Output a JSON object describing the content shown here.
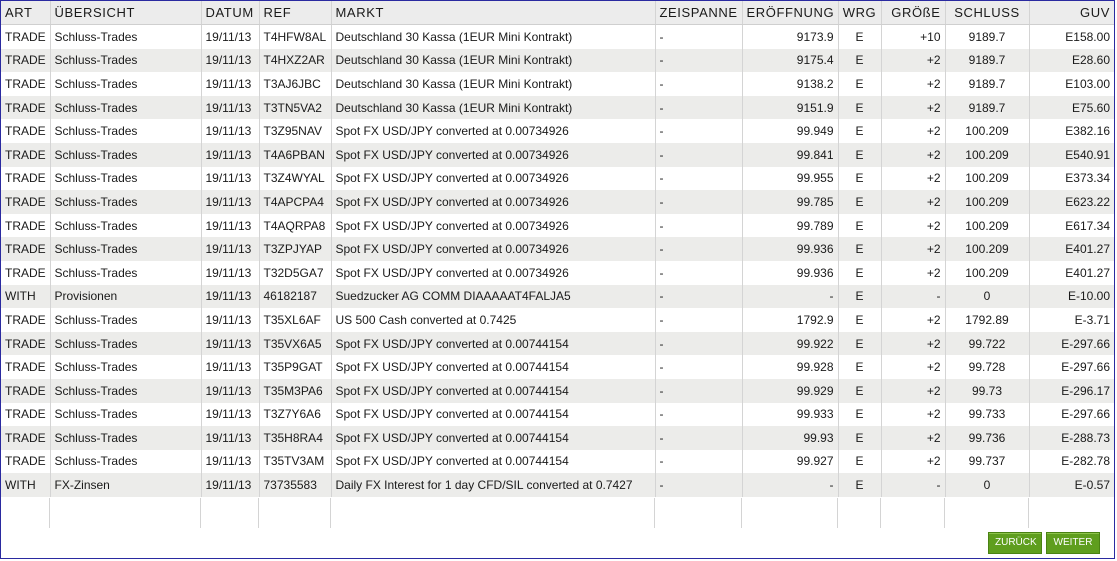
{
  "columns": [
    "ART",
    "ÜBERSICHT",
    "DATUM",
    "REF",
    "MARKT",
    "ZEISPANNE",
    "ERÖFFNUNG",
    "WRG",
    "GRÖßE",
    "SCHLUSS",
    "GUV"
  ],
  "rows": [
    [
      "TRADE",
      "Schluss-Trades",
      "19/11/13",
      "T4HFW8AL",
      "Deutschland 30 Kassa (1EUR Mini Kontrakt)",
      "-",
      "9173.9",
      "E",
      "+10",
      "9189.7",
      "E158.00"
    ],
    [
      "TRADE",
      "Schluss-Trades",
      "19/11/13",
      "T4HXZ2AR",
      "Deutschland 30 Kassa (1EUR Mini Kontrakt)",
      "-",
      "9175.4",
      "E",
      "+2",
      "9189.7",
      "E28.60"
    ],
    [
      "TRADE",
      "Schluss-Trades",
      "19/11/13",
      "T3AJ6JBC",
      "Deutschland 30 Kassa (1EUR Mini Kontrakt)",
      "-",
      "9138.2",
      "E",
      "+2",
      "9189.7",
      "E103.00"
    ],
    [
      "TRADE",
      "Schluss-Trades",
      "19/11/13",
      "T3TN5VA2",
      "Deutschland 30 Kassa (1EUR Mini Kontrakt)",
      "-",
      "9151.9",
      "E",
      "+2",
      "9189.7",
      "E75.60"
    ],
    [
      "TRADE",
      "Schluss-Trades",
      "19/11/13",
      "T3Z95NAV",
      "Spot FX USD/JPY converted at 0.00734926",
      "-",
      "99.949",
      "E",
      "+2",
      "100.209",
      "E382.16"
    ],
    [
      "TRADE",
      "Schluss-Trades",
      "19/11/13",
      "T4A6PBAN",
      "Spot FX USD/JPY converted at 0.00734926",
      "-",
      "99.841",
      "E",
      "+2",
      "100.209",
      "E540.91"
    ],
    [
      "TRADE",
      "Schluss-Trades",
      "19/11/13",
      "T3Z4WYAL",
      "Spot FX USD/JPY converted at 0.00734926",
      "-",
      "99.955",
      "E",
      "+2",
      "100.209",
      "E373.34"
    ],
    [
      "TRADE",
      "Schluss-Trades",
      "19/11/13",
      "T4APCPA4",
      "Spot FX USD/JPY converted at 0.00734926",
      "-",
      "99.785",
      "E",
      "+2",
      "100.209",
      "E623.22"
    ],
    [
      "TRADE",
      "Schluss-Trades",
      "19/11/13",
      "T4AQRPA8",
      "Spot FX USD/JPY converted at 0.00734926",
      "-",
      "99.789",
      "E",
      "+2",
      "100.209",
      "E617.34"
    ],
    [
      "TRADE",
      "Schluss-Trades",
      "19/11/13",
      "T3ZPJYAP",
      "Spot FX USD/JPY converted at 0.00734926",
      "-",
      "99.936",
      "E",
      "+2",
      "100.209",
      "E401.27"
    ],
    [
      "TRADE",
      "Schluss-Trades",
      "19/11/13",
      "T32D5GA7",
      "Spot FX USD/JPY converted at 0.00734926",
      "-",
      "99.936",
      "E",
      "+2",
      "100.209",
      "E401.27"
    ],
    [
      "WITH",
      "Provisionen",
      "19/11/13",
      "46182187",
      "Suedzucker AG COMM DIAAAAAT4FALJA5",
      "-",
      "-",
      "E",
      "-",
      "0",
      "E-10.00"
    ],
    [
      "TRADE",
      "Schluss-Trades",
      "19/11/13",
      "T35XL6AF",
      "US 500 Cash converted at 0.7425",
      "-",
      "1792.9",
      "E",
      "+2",
      "1792.89",
      "E-3.71"
    ],
    [
      "TRADE",
      "Schluss-Trades",
      "19/11/13",
      "T35VX6A5",
      "Spot FX USD/JPY converted at 0.00744154",
      "-",
      "99.922",
      "E",
      "+2",
      "99.722",
      "E-297.66"
    ],
    [
      "TRADE",
      "Schluss-Trades",
      "19/11/13",
      "T35P9GAT",
      "Spot FX USD/JPY converted at 0.00744154",
      "-",
      "99.928",
      "E",
      "+2",
      "99.728",
      "E-297.66"
    ],
    [
      "TRADE",
      "Schluss-Trades",
      "19/11/13",
      "T35M3PA6",
      "Spot FX USD/JPY converted at 0.00744154",
      "-",
      "99.929",
      "E",
      "+2",
      "99.73",
      "E-296.17"
    ],
    [
      "TRADE",
      "Schluss-Trades",
      "19/11/13",
      "T3Z7Y6A6",
      "Spot FX USD/JPY converted at 0.00744154",
      "-",
      "99.933",
      "E",
      "+2",
      "99.733",
      "E-297.66"
    ],
    [
      "TRADE",
      "Schluss-Trades",
      "19/11/13",
      "T35H8RA4",
      "Spot FX USD/JPY converted at 0.00744154",
      "-",
      "99.93",
      "E",
      "+2",
      "99.736",
      "E-288.73"
    ],
    [
      "TRADE",
      "Schluss-Trades",
      "19/11/13",
      "T35TV3AM",
      "Spot FX USD/JPY converted at 0.00744154",
      "-",
      "99.927",
      "E",
      "+2",
      "99.737",
      "E-282.78"
    ],
    [
      "WITH",
      "FX-Zinsen",
      "19/11/13",
      "73735583",
      "Daily FX Interest for 1 day CFD/SIL converted at 0.7427",
      "-",
      "-",
      "E",
      "-",
      "0",
      "E-0.57"
    ]
  ],
  "buttons": {
    "back_label": "ZURÜCK",
    "next_label": "WEITER",
    "color": "#5f9e1e"
  }
}
